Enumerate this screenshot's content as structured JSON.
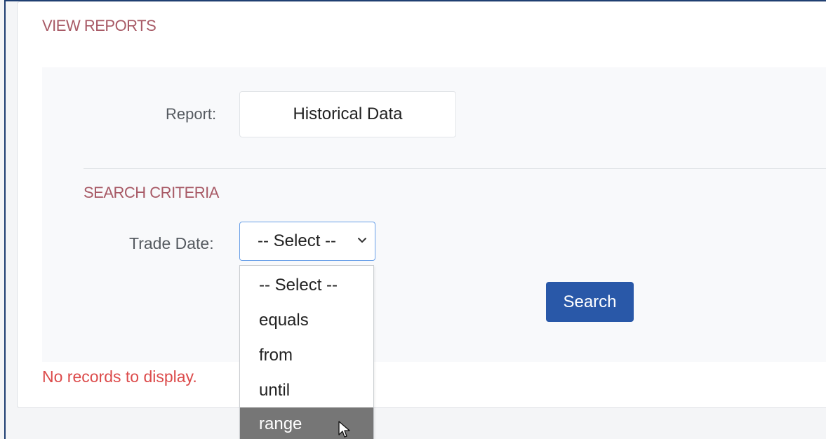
{
  "panel": {
    "title": "VIEW REPORTS"
  },
  "report": {
    "label": "Report:",
    "value": "Historical Data"
  },
  "criteria": {
    "title": "SEARCH CRITERIA",
    "trade_date": {
      "label": "Trade Date:",
      "selected": "-- Select --",
      "options": [
        "-- Select --",
        "equals",
        "from",
        "until",
        "range"
      ],
      "highlighted_option": "range"
    }
  },
  "actions": {
    "search_label": "Search"
  },
  "status": {
    "message": "No records to display."
  },
  "icons": {
    "select_chevron": "chevron-down-icon",
    "cursor": "mouse-pointer-icon"
  },
  "colors": {
    "section_title": "#a85a66",
    "primary_button": "#2958a8",
    "error_text": "#dc4b4b",
    "highlight_option": "#767676",
    "focus_border": "#6aa0e8"
  }
}
